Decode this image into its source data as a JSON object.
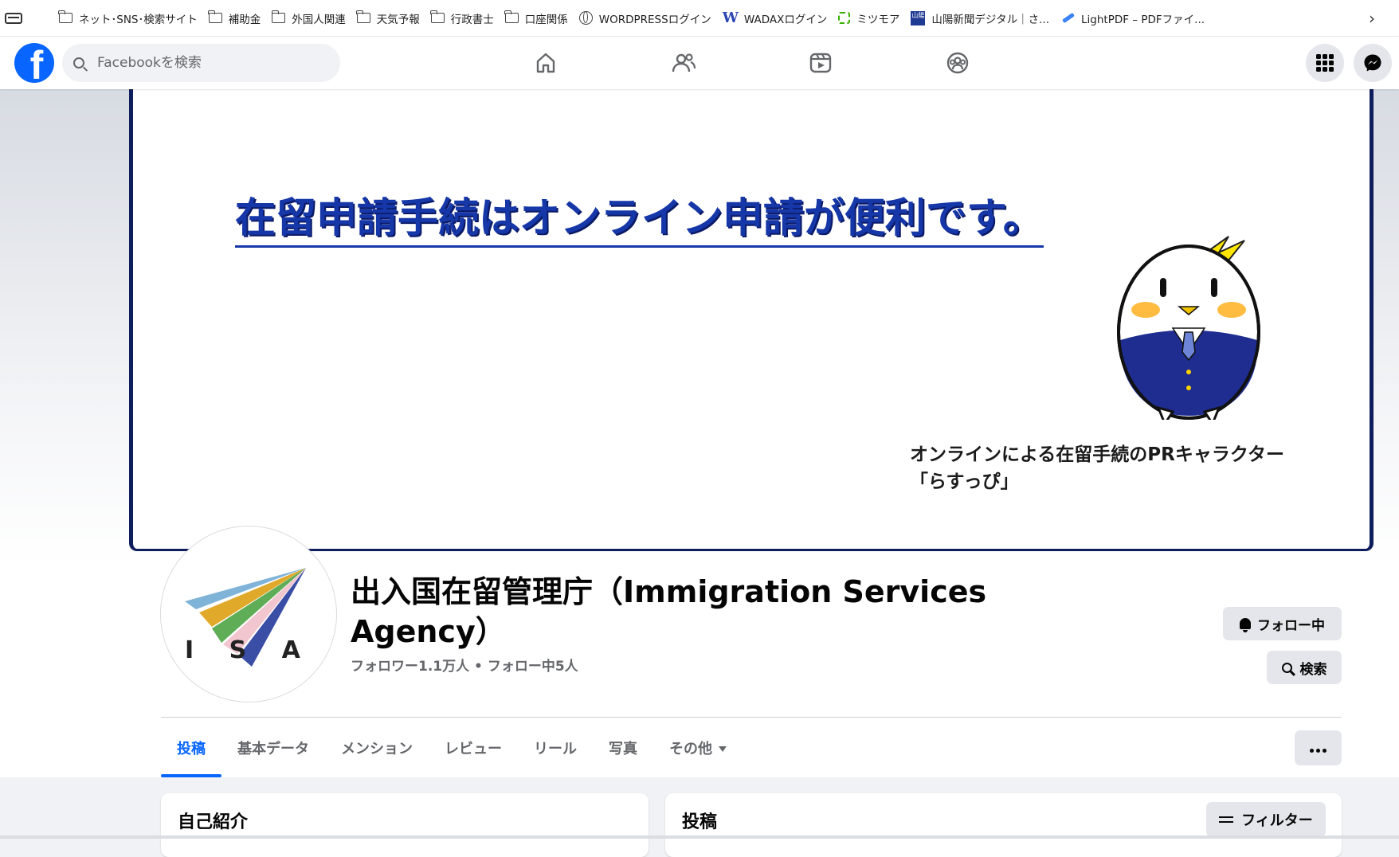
{
  "bookmarks": {
    "items": [
      {
        "label": "ネット･SNS･検索サイト",
        "icon": "folder-icon"
      },
      {
        "label": "補助金",
        "icon": "folder-icon"
      },
      {
        "label": "外国人関連",
        "icon": "folder-icon"
      },
      {
        "label": "天気予報",
        "icon": "folder-icon"
      },
      {
        "label": "行政書士",
        "icon": "folder-icon"
      },
      {
        "label": "口座関係",
        "icon": "folder-icon"
      },
      {
        "label": "WORDPRESSログイン",
        "icon": "globe-icon"
      },
      {
        "label": "WADAXログイン",
        "icon": "wadax-logo-icon"
      },
      {
        "label": "ミツモア",
        "icon": "mitsumoa-icon"
      },
      {
        "label": "山陽新聞デジタル｜さ...",
        "icon": "sanyo-shimbun-icon"
      },
      {
        "label": "LightPDF – PDFファイ...",
        "icon": "lightpdf-icon"
      }
    ],
    "more": "›"
  },
  "header": {
    "logo_letter": "f",
    "search_placeholder": "Facebookを検索",
    "nav": [
      "home-icon",
      "friends-icon",
      "video-icon",
      "groups-icon"
    ],
    "right_buttons": [
      "menu-grid-icon",
      "messenger-icon"
    ]
  },
  "cover": {
    "headline": "在留申請手続はオンライン申請が便利です。",
    "caption_line1": "オンラインによる在留手続のPRキャラクター",
    "caption_line2": "「らすっぴ」"
  },
  "profile": {
    "avatar_text": "I S A",
    "name": "出入国在留管理庁（Immigration Services Agency）",
    "stats": "フォロワー1.1万人 • フォロー中5人",
    "follow_label": "フォロー中",
    "search_label": "検索"
  },
  "tabs": [
    {
      "label": "投稿",
      "active": true
    },
    {
      "label": "基本データ",
      "active": false
    },
    {
      "label": "メンション",
      "active": false
    },
    {
      "label": "レビュー",
      "active": false
    },
    {
      "label": "リール",
      "active": false
    },
    {
      "label": "写真",
      "active": false
    },
    {
      "label": "その他",
      "active": false
    }
  ],
  "cards": {
    "intro_title": "自己紹介",
    "posts_title": "投稿",
    "filter_label": "フィルター"
  },
  "colors": {
    "brand": "#0866ff",
    "cover_headline": "#1637a8",
    "cover_frame": "#0e1d5c"
  }
}
